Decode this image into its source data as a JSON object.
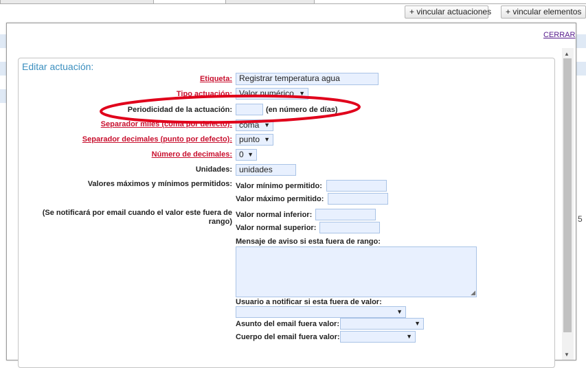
{
  "toolbar": {
    "link_actuaciones": "+ vincular actuaciones",
    "link_elementos": "+ vincular elementos"
  },
  "background": {
    "edge_number": "5"
  },
  "dialog": {
    "close_label": "CERRAR",
    "legend": "Editar actuación:",
    "fields": {
      "etiqueta": {
        "label": "Etiqueta:",
        "value": "Registrar temperatura agua"
      },
      "tipo": {
        "label": "Tipo actuación:",
        "value": "Valor numérico"
      },
      "periodicidad": {
        "label": "Periodicidad de la actuación:",
        "value": "",
        "hint": "(en número de días)"
      },
      "separador_miles": {
        "label": "Separador miles (coma por defecto):",
        "value": "coma"
      },
      "separador_decimales": {
        "label": "Separador decimales (punto por defecto):",
        "value": "punto"
      },
      "num_decimales": {
        "label": "Número de decimales:",
        "value": "0"
      },
      "unidades": {
        "label": "Unidades:",
        "value": "unidades"
      },
      "valores_permitidos": {
        "label": "Valores máximos y mínimos permitidos:",
        "min_label": "Valor mínimo permitido:",
        "min_value": "",
        "max_label": "Valor máximo permitido:",
        "max_value": ""
      },
      "rango_normal": {
        "label": "(Se notificará por email cuando el valor este fuera de rango)",
        "inf_label": "Valor normal inferior:",
        "inf_value": "",
        "sup_label": "Valor normal superior:",
        "sup_value": ""
      },
      "mensaje": {
        "label": "Mensaje de aviso si esta fuera de rango:",
        "value": ""
      },
      "usuario": {
        "label": "Usuario a notificar si esta fuera de valor:",
        "value": ""
      },
      "asunto": {
        "label": "Asunto del email fuera valor:",
        "value": ""
      },
      "cuerpo": {
        "label": "Cuerpo del email fuera valor:",
        "value": ""
      }
    }
  },
  "colors": {
    "required_label": "#c8102e",
    "legend": "#3b8fbf",
    "input_bg": "#e8f0fe",
    "annotation": "#e0001b"
  },
  "icons": {
    "dropdown": "dropdown-arrow-icon",
    "resize": "resize-grip-icon"
  }
}
